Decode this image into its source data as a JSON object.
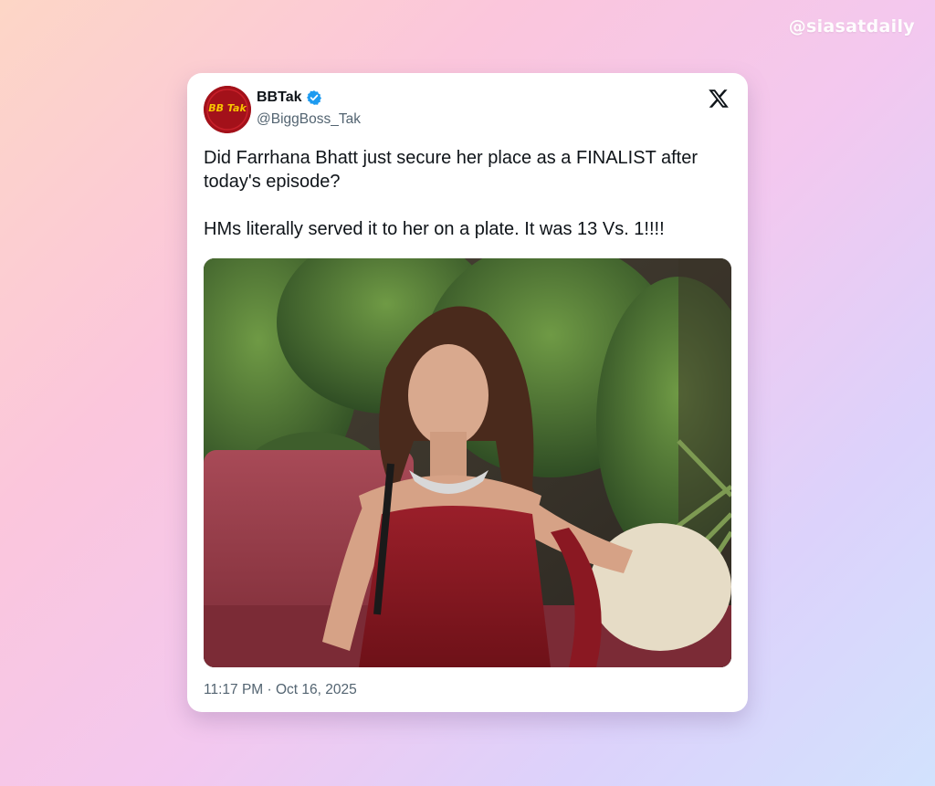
{
  "watermark": "@siasatdaily",
  "tweet": {
    "author": {
      "display_name": "BBTak",
      "handle": "@BiggBoss_Tak",
      "verified": true,
      "avatar_text": "BB Tak"
    },
    "paragraphs": [
      "Did Farrhana Bhatt just secure her place as a FINALIST after today's episode?",
      "HMs literally served it to her on a plate. It was 13 Vs. 1!!!!"
    ],
    "timestamp": "11:17 PM · Oct 16, 2025"
  },
  "colors": {
    "accent_blue": "#1d9bf0",
    "text_primary": "#0f1419",
    "text_secondary": "#536471",
    "avatar_red": "#a3111a",
    "avatar_yellow": "#f7c400"
  },
  "icons": {
    "platform": "x-logo-icon",
    "verified": "verified-badge-icon"
  }
}
